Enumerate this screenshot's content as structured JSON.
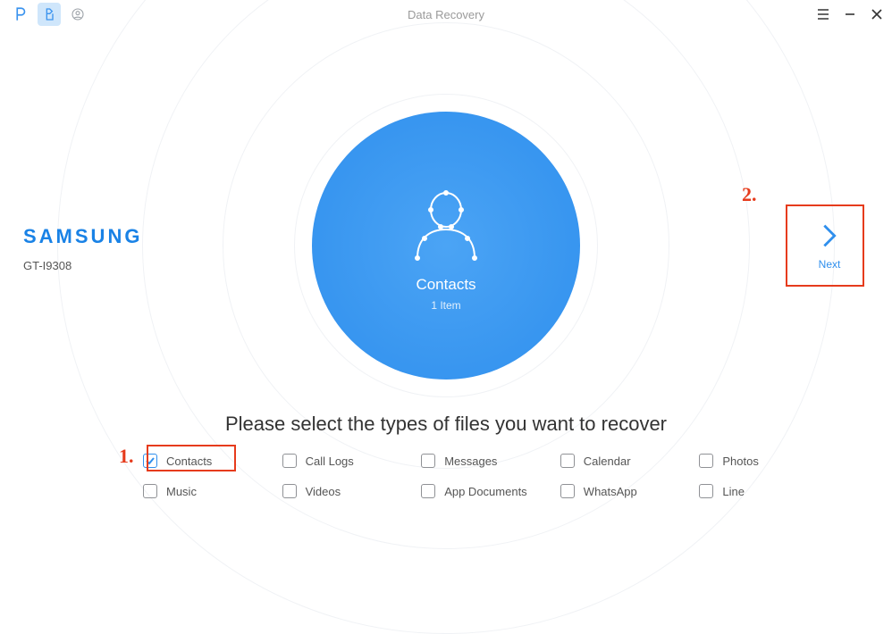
{
  "window": {
    "title": "Data Recovery"
  },
  "device": {
    "brand": "SAMSUNG",
    "model": "GT-I9308"
  },
  "center": {
    "category": "Contacts",
    "count": "1 Item"
  },
  "next": {
    "label": "Next"
  },
  "instruction": "Please select the types of files you want to recover",
  "filetypes": [
    {
      "label": "Contacts",
      "checked": true
    },
    {
      "label": "Call Logs",
      "checked": false
    },
    {
      "label": "Messages",
      "checked": false
    },
    {
      "label": "Calendar",
      "checked": false
    },
    {
      "label": "Photos",
      "checked": false
    },
    {
      "label": "Music",
      "checked": false
    },
    {
      "label": "Videos",
      "checked": false
    },
    {
      "label": "App Documents",
      "checked": false
    },
    {
      "label": "WhatsApp",
      "checked": false
    },
    {
      "label": "Line",
      "checked": false
    }
  ],
  "annotations": {
    "one": "1.",
    "two": "2."
  }
}
